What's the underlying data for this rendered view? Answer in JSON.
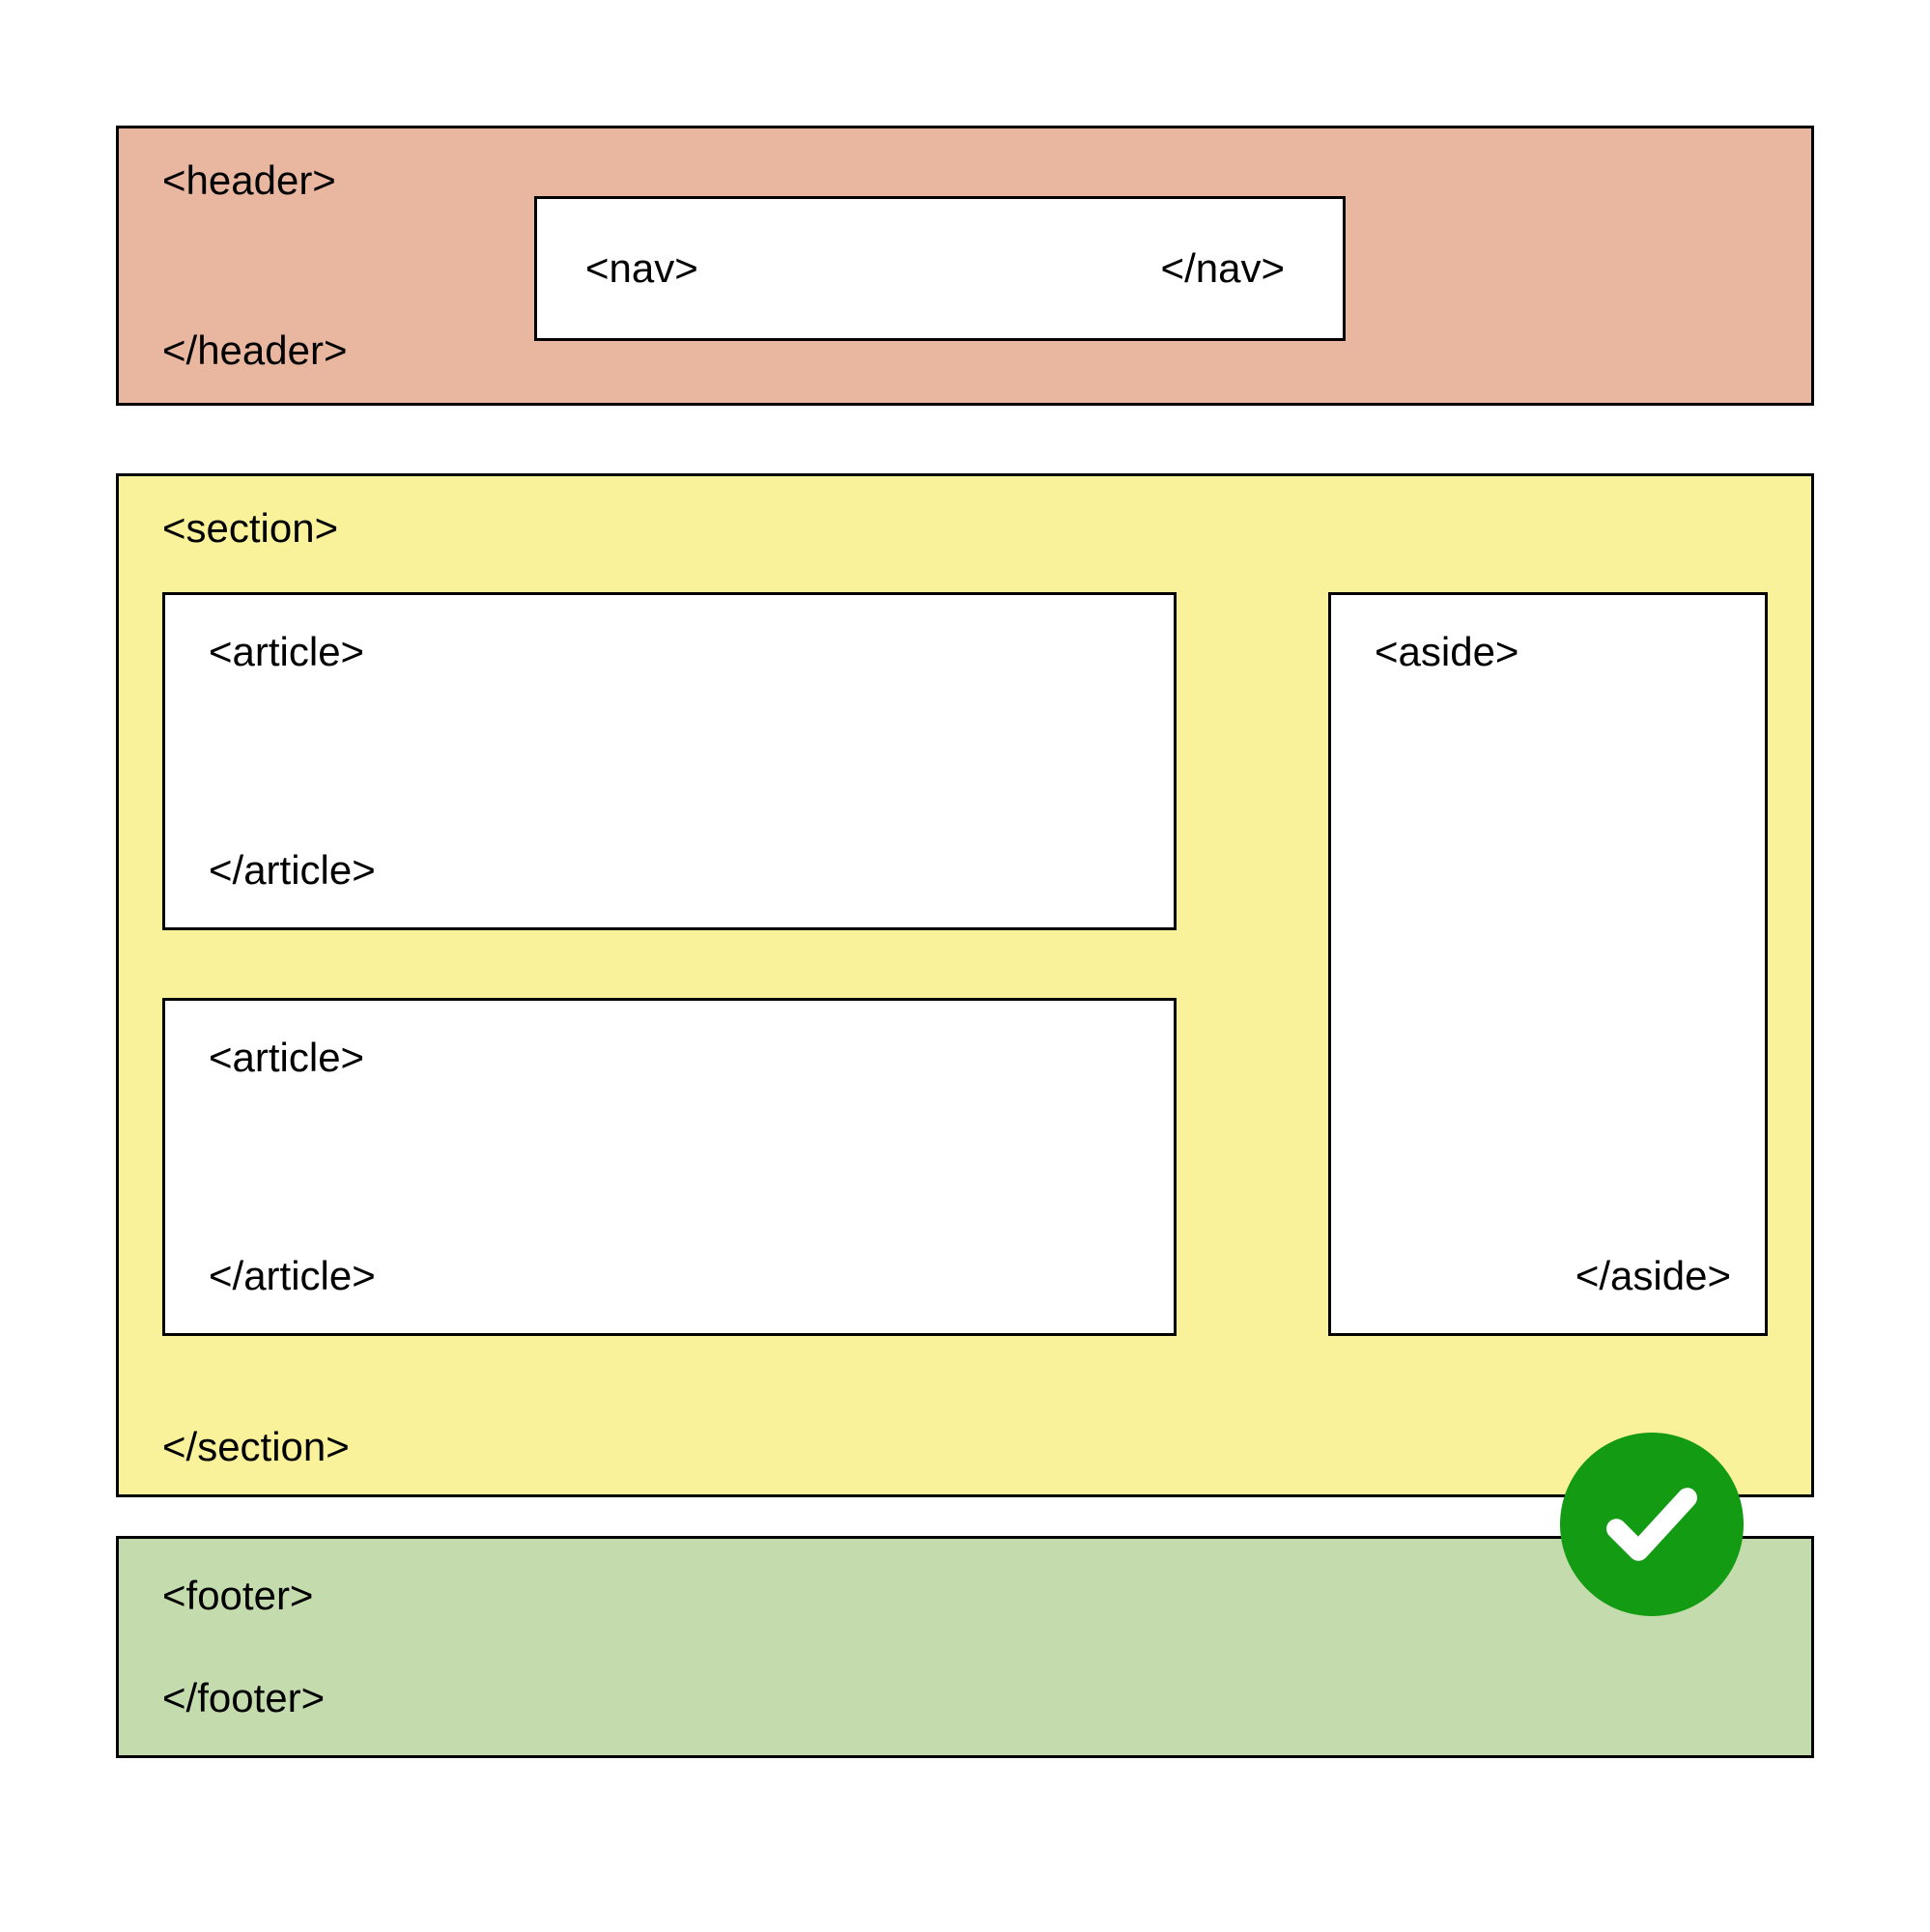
{
  "header": {
    "open": "<header>",
    "close": "</header>",
    "nav": {
      "open": "<nav>",
      "close": "</nav>"
    }
  },
  "section": {
    "open": "<section>",
    "close": "</section>",
    "articles": [
      {
        "open": "<article>",
        "close": "</article>"
      },
      {
        "open": "<article>",
        "close": "</article>"
      }
    ],
    "aside": {
      "open": "<aside>",
      "close": "</aside>"
    }
  },
  "footer": {
    "open": "<footer>",
    "close": "</footer>"
  },
  "colors": {
    "header_bg": "#e9b69f",
    "section_bg": "#faf29b",
    "footer_bg": "#c4dcad",
    "badge_bg": "#139c13"
  }
}
